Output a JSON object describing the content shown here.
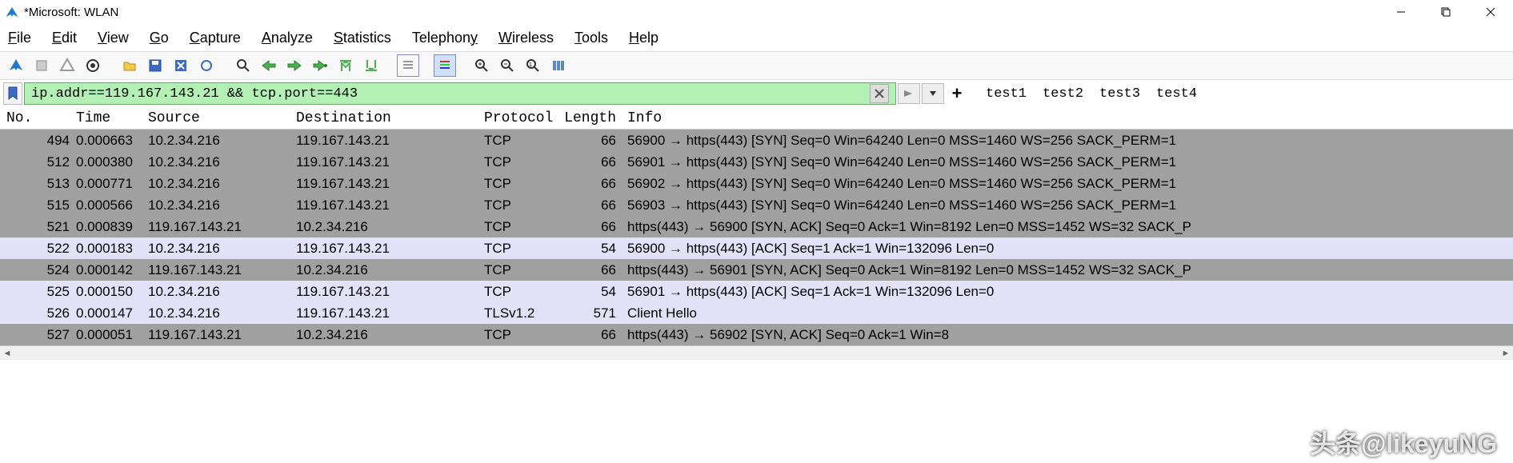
{
  "window": {
    "title": "*Microsoft: WLAN"
  },
  "menu": {
    "file": "File",
    "edit": "Edit",
    "view": "View",
    "go": "Go",
    "capture": "Capture",
    "analyze": "Analyze",
    "statistics": "Statistics",
    "telephony": "Telephony",
    "wireless": "Wireless",
    "tools": "Tools",
    "help": "Help"
  },
  "filter": {
    "expression": "ip.addr==119.167.143.21 && tcp.port==443",
    "tabs": [
      "test1",
      "test2",
      "test3",
      "test4"
    ]
  },
  "columns": {
    "no": "No.",
    "time": "Time",
    "source": "Source",
    "destination": "Destination",
    "protocol": "Protocol",
    "length": "Length",
    "info": "Info"
  },
  "packets": [
    {
      "no": "494",
      "time": "0.000663",
      "src": "10.2.34.216",
      "dst": "119.167.143.21",
      "proto": "TCP",
      "len": "66",
      "info": "56900 → https(443) [SYN] Seq=0 Win=64240 Len=0 MSS=1460 WS=256 SACK_PERM=1",
      "cls": "gray"
    },
    {
      "no": "512",
      "time": "0.000380",
      "src": "10.2.34.216",
      "dst": "119.167.143.21",
      "proto": "TCP",
      "len": "66",
      "info": "56901 → https(443) [SYN] Seq=0 Win=64240 Len=0 MSS=1460 WS=256 SACK_PERM=1",
      "cls": "gray"
    },
    {
      "no": "513",
      "time": "0.000771",
      "src": "10.2.34.216",
      "dst": "119.167.143.21",
      "proto": "TCP",
      "len": "66",
      "info": "56902 → https(443) [SYN] Seq=0 Win=64240 Len=0 MSS=1460 WS=256 SACK_PERM=1",
      "cls": "gray"
    },
    {
      "no": "515",
      "time": "0.000566",
      "src": "10.2.34.216",
      "dst": "119.167.143.21",
      "proto": "TCP",
      "len": "66",
      "info": "56903 → https(443) [SYN] Seq=0 Win=64240 Len=0 MSS=1460 WS=256 SACK_PERM=1",
      "cls": "gray"
    },
    {
      "no": "521",
      "time": "0.000839",
      "src": "119.167.143.21",
      "dst": "10.2.34.216",
      "proto": "TCP",
      "len": "66",
      "info": "https(443) → 56900 [SYN, ACK] Seq=0 Ack=1 Win=8192 Len=0 MSS=1452 WS=32 SACK_P",
      "cls": "gray"
    },
    {
      "no": "522",
      "time": "0.000183",
      "src": "10.2.34.216",
      "dst": "119.167.143.21",
      "proto": "TCP",
      "len": "54",
      "info": "56900 → https(443) [ACK] Seq=1 Ack=1 Win=132096 Len=0",
      "cls": "lav"
    },
    {
      "no": "524",
      "time": "0.000142",
      "src": "119.167.143.21",
      "dst": "10.2.34.216",
      "proto": "TCP",
      "len": "66",
      "info": "https(443) → 56901 [SYN, ACK] Seq=0 Ack=1 Win=8192 Len=0 MSS=1452 WS=32 SACK_P",
      "cls": "gray"
    },
    {
      "no": "525",
      "time": "0.000150",
      "src": "10.2.34.216",
      "dst": "119.167.143.21",
      "proto": "TCP",
      "len": "54",
      "info": "56901 → https(443) [ACK] Seq=1 Ack=1 Win=132096 Len=0",
      "cls": "lav"
    },
    {
      "no": "526",
      "time": "0.000147",
      "src": "10.2.34.216",
      "dst": "119.167.143.21",
      "proto": "TLSv1.2",
      "len": "571",
      "info": "Client Hello",
      "cls": "lav"
    },
    {
      "no": "527",
      "time": "0.000051",
      "src": "119.167.143.21",
      "dst": "10.2.34.216",
      "proto": "TCP",
      "len": "66",
      "info": "https(443) → 56902 [SYN, ACK] Seq=0 Ack=1 Win=8",
      "cls": "gray"
    }
  ],
  "watermark": "头条@likeyuNG"
}
